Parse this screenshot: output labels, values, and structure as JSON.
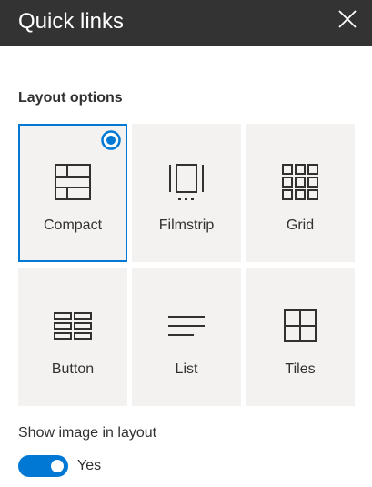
{
  "panel": {
    "title": "Quick links",
    "close_icon": "close-icon"
  },
  "layout_options": {
    "heading": "Layout options",
    "selected": "Compact",
    "accent_color": "#0078d4",
    "items": [
      {
        "label": "Compact",
        "icon": "compact-layout-icon",
        "selected": true
      },
      {
        "label": "Filmstrip",
        "icon": "filmstrip-layout-icon",
        "selected": false
      },
      {
        "label": "Grid",
        "icon": "grid-layout-icon",
        "selected": false
      },
      {
        "label": "Button",
        "icon": "button-layout-icon",
        "selected": false
      },
      {
        "label": "List",
        "icon": "list-layout-icon",
        "selected": false
      },
      {
        "label": "Tiles",
        "icon": "tiles-layout-icon",
        "selected": false
      }
    ]
  },
  "show_image": {
    "label": "Show image in layout",
    "state_text": "Yes",
    "enabled": true
  }
}
